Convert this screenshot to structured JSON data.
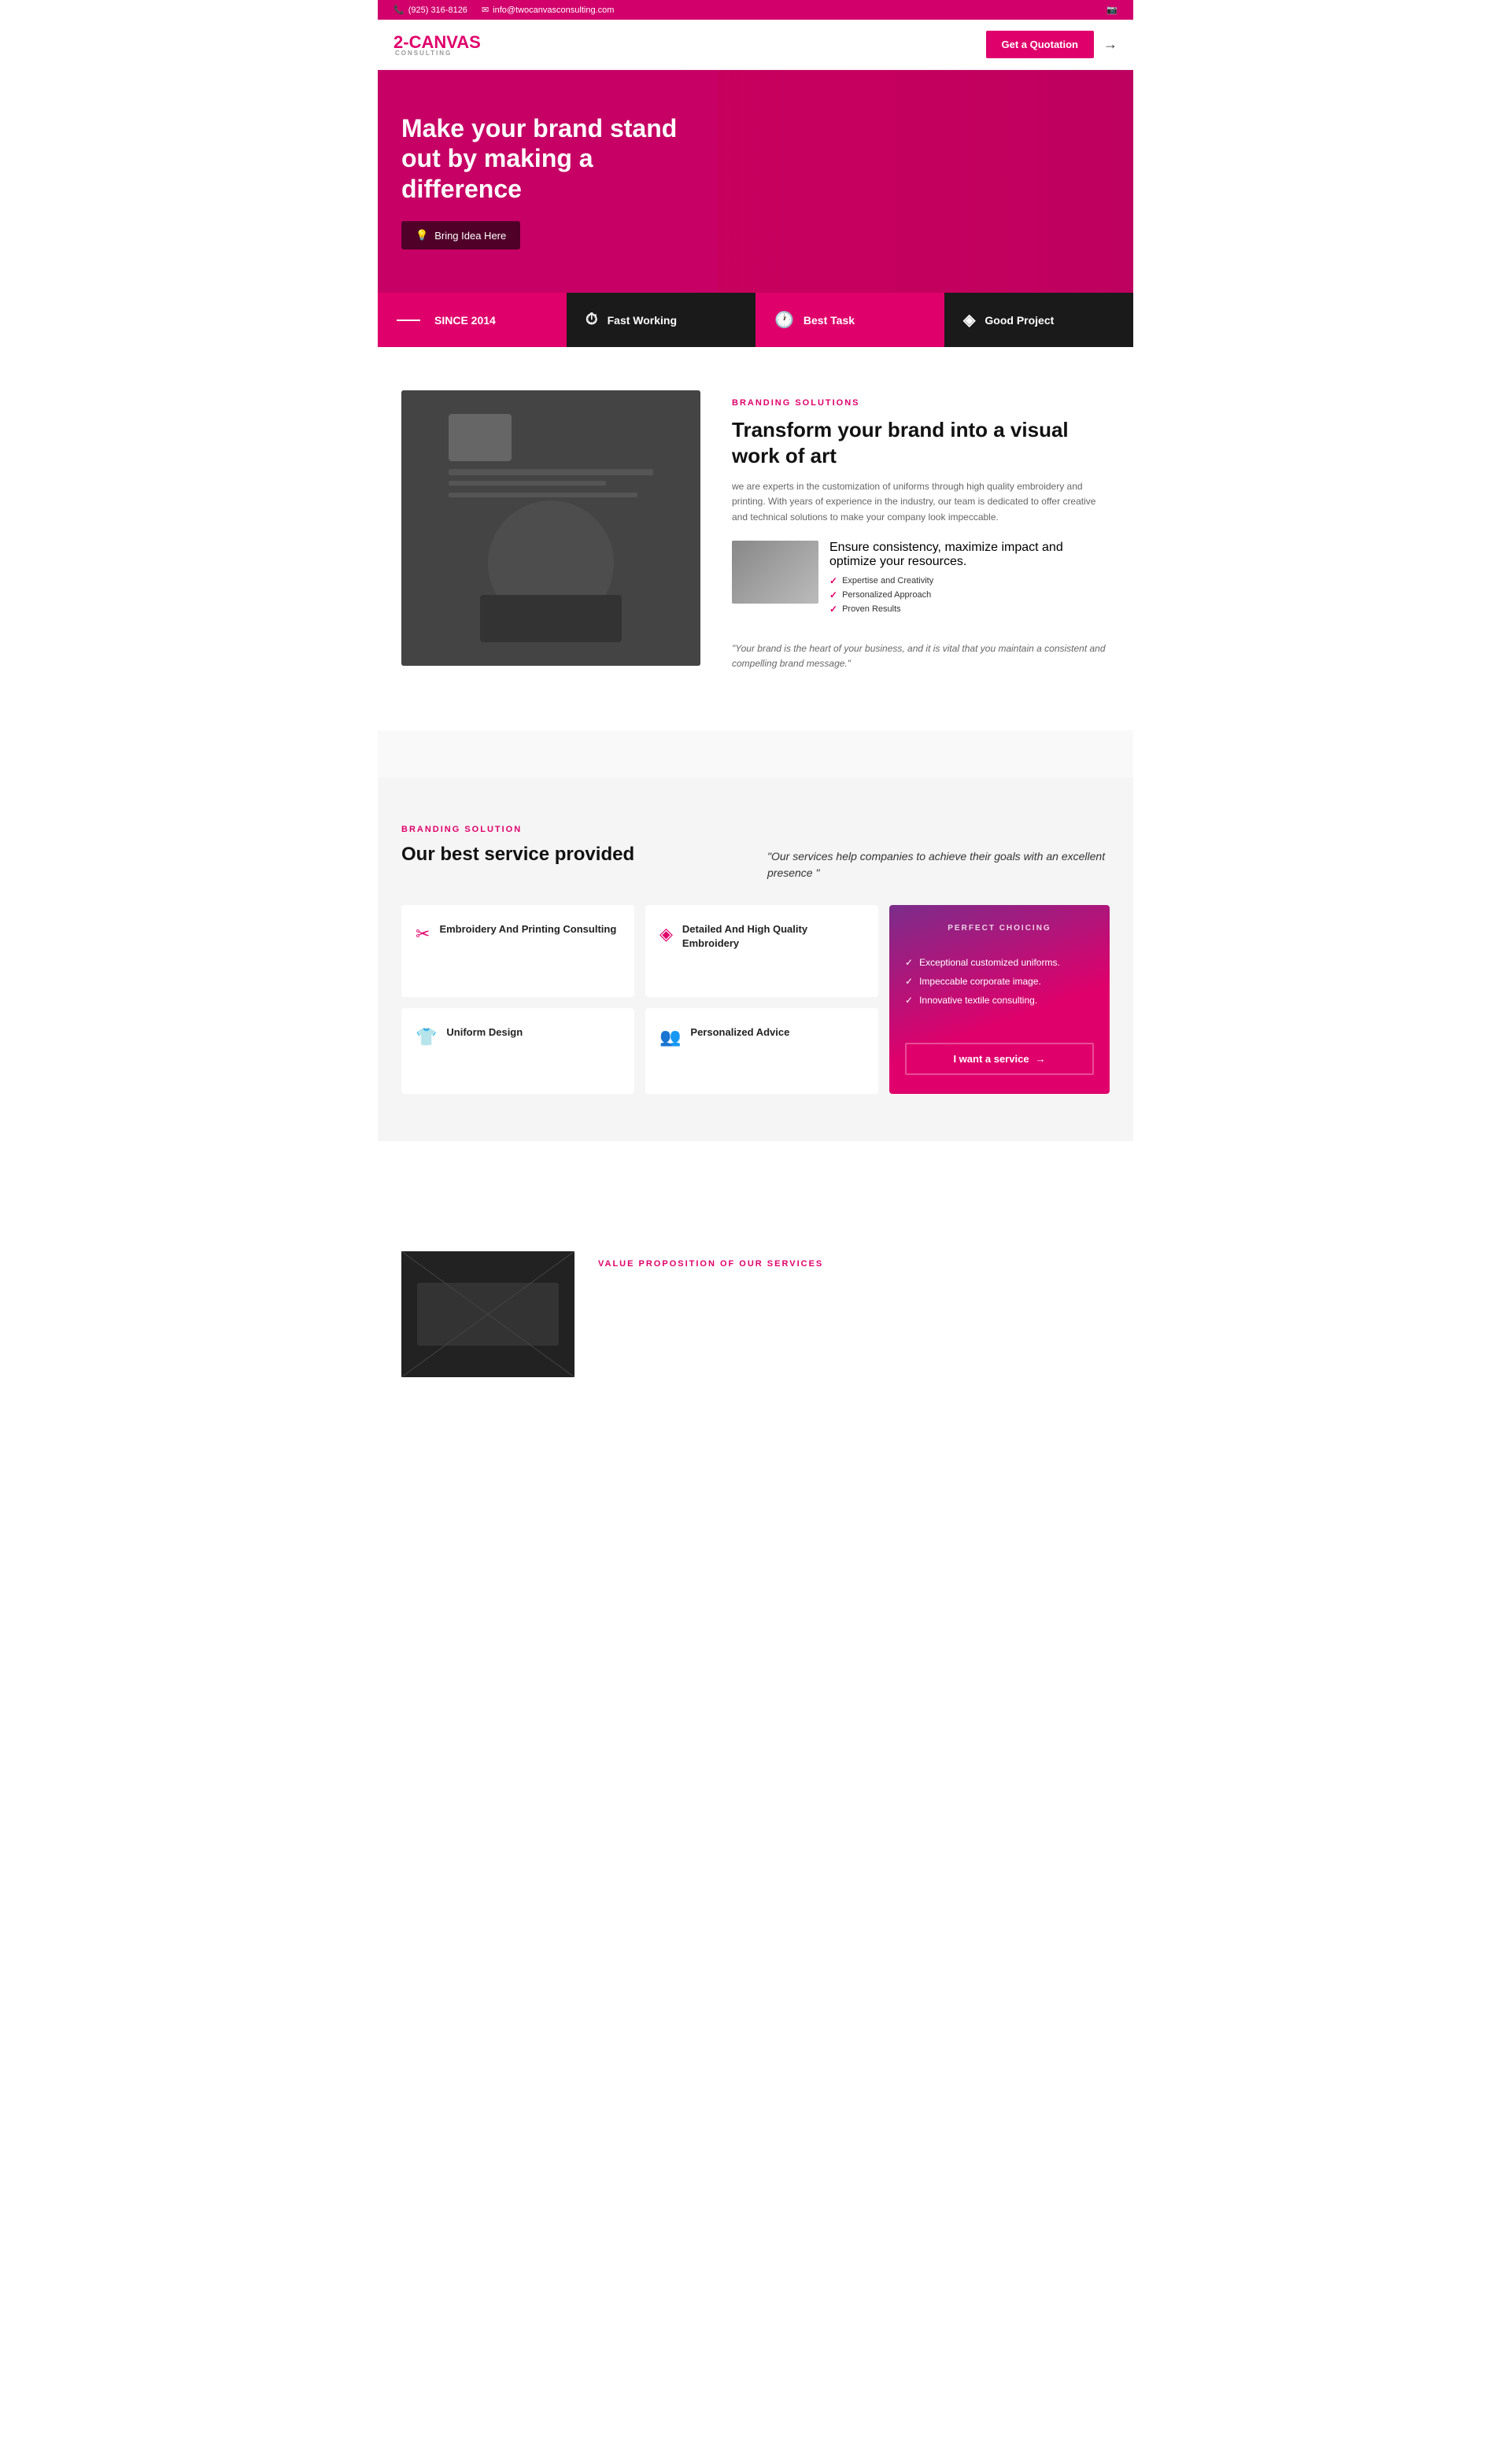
{
  "topbar": {
    "phone": "(925) 316-8126",
    "email": "info@twocanvasconsulting.com",
    "phone_label": "(925) 316-8126",
    "email_label": "info@twocanvasconsulting.com"
  },
  "header": {
    "logo_text": "2-CANVAS",
    "logo_sub": "CONSULTING",
    "cta_button": "Get a Quotation"
  },
  "hero": {
    "headline": "Make your brand stand out by making a difference",
    "cta_button": "Bring Idea Here"
  },
  "stats": [
    {
      "label": "SINCE 2014",
      "icon": "—"
    },
    {
      "label": "Fast Working",
      "icon": "⏱"
    },
    {
      "label": "Best Task",
      "icon": "🕐"
    },
    {
      "label": "Good Project",
      "icon": "◈"
    }
  ],
  "branding_section": {
    "section_label": "BRANDING SOLUTIONS",
    "heading": "Transform your brand into a visual work of art",
    "description": "we are experts in the customization of uniforms through high quality embroidery and printing. With years of experience in the industry, our team is dedicated to offer creative and technical solutions to make your company look impeccable.",
    "mini_text": "Ensure consistency, maximize impact and optimize your resources.",
    "checklist": [
      "Expertise and Creativity",
      "Personalized Approach",
      "Proven Results"
    ],
    "quote": "\"Your brand is the heart of your business, and it is vital that you maintain a consistent and compelling brand message.\""
  },
  "services_section": {
    "section_label": "BRANDING SOLUTION",
    "heading": "Our best service provided",
    "tagline": "\"Our services help companies to achieve their goals with an excellent presence \"",
    "services": [
      {
        "name": "Embroidery And Printing Consulting",
        "icon": "✂"
      },
      {
        "name": "Detailed And High Quality Embroidery",
        "icon": "◈"
      },
      {
        "name": "Uniform Design",
        "icon": "👕"
      },
      {
        "name": "Personalized Advice",
        "icon": "👥"
      }
    ],
    "perfect_card": {
      "label": "PERFECT CHOICING",
      "items": [
        "Exceptional customized uniforms.",
        "Impeccable corporate image.",
        "Innovative textile consulting."
      ],
      "button": "I want a service"
    }
  },
  "bottom_teaser": {
    "label": "VALUE PROPOSITION OF OUR SERVICES"
  }
}
